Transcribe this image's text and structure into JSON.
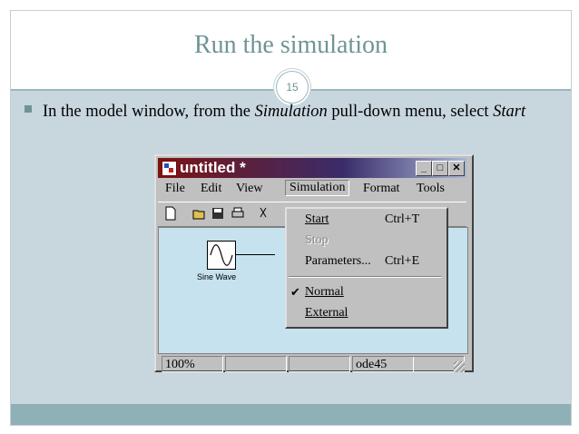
{
  "slide": {
    "title": "Run the simulation",
    "number": "15",
    "bullet_pre": "In the model window, from the ",
    "bullet_sim": "Simulation",
    "bullet_mid": " pull-down menu, select ",
    "bullet_start": "Start"
  },
  "window": {
    "title": "untitled *",
    "controls": {
      "minimize": "_",
      "maximize": "□",
      "close": "✕"
    },
    "menus": [
      "File",
      "Edit",
      "View",
      "Simulation",
      "Format",
      "Tools"
    ],
    "block_label": "Sine Wave",
    "status": {
      "zoom": "100%",
      "solver": "ode45"
    }
  },
  "dropdown": {
    "items": [
      {
        "label": "Start",
        "shortcut": "Ctrl+T",
        "enabled": true
      },
      {
        "label": "Stop",
        "shortcut": "",
        "enabled": false
      },
      {
        "label": "Parameters...",
        "shortcut": "Ctrl+E",
        "enabled": true
      },
      {
        "label": "Normal",
        "shortcut": "",
        "checked": true
      },
      {
        "label": "External",
        "shortcut": ""
      }
    ]
  },
  "colors": {
    "accent": "#6f9495",
    "content_bg": "#c8d6de",
    "footer": "#8fb0b7",
    "canvas": "#c6e2ee"
  }
}
